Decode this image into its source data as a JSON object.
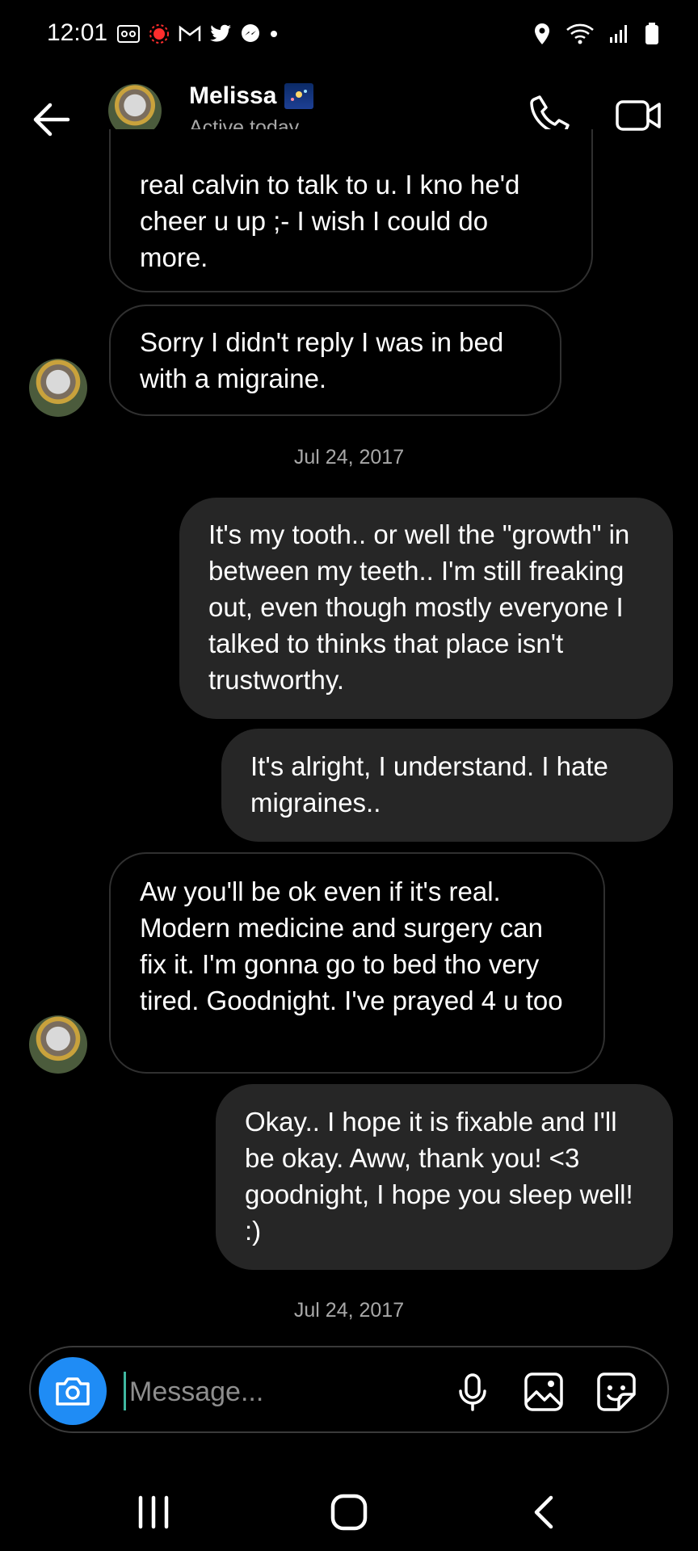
{
  "status_bar": {
    "time": "12:01"
  },
  "header": {
    "contact_name": "Melissa",
    "contact_status": "Active today",
    "back_icon": "arrow-left-icon",
    "call_icon": "phone-icon",
    "video_icon": "video-camera-icon"
  },
  "messages": [
    {
      "direction": "incoming",
      "text": "real calvin to talk to u. I kno he'd cheer u up ;- I wish I could do more."
    },
    {
      "direction": "incoming",
      "text": "Sorry I didn't reply I was in bed with a migraine."
    },
    {
      "direction": "outgoing",
      "text": "It's my tooth.. or well the \"growth\" in between my teeth.. I'm still freaking out, even though mostly everyone I talked to thinks that place isn't trustworthy."
    },
    {
      "direction": "outgoing",
      "text": "It's alright, I understand. I hate migraines.."
    },
    {
      "direction": "incoming",
      "text": "Aw you'll be ok even if it's real. Modern medicine and surgery can fix it. I'm gonna go to bed tho very tired. Goodnight. I've prayed 4 u too"
    },
    {
      "direction": "outgoing",
      "text": "Okay.. I hope it is fixable and I'll be okay. Aww, thank you! <3 goodnight, I hope you sleep well! :)"
    }
  ],
  "dates": [
    "Jul 24, 2017",
    "Jul 24, 2017"
  ],
  "composer": {
    "placeholder": "Message...",
    "camera_icon": "camera-icon",
    "mic_icon": "microphone-icon",
    "gallery_icon": "image-icon",
    "sticker_icon": "sticker-icon"
  },
  "colors": {
    "background": "#000000",
    "outgoing_bubble": "#262626",
    "incoming_bubble_border": "#303030",
    "accent": "#1f8cf5",
    "secondary_text": "#a8a8a8"
  }
}
